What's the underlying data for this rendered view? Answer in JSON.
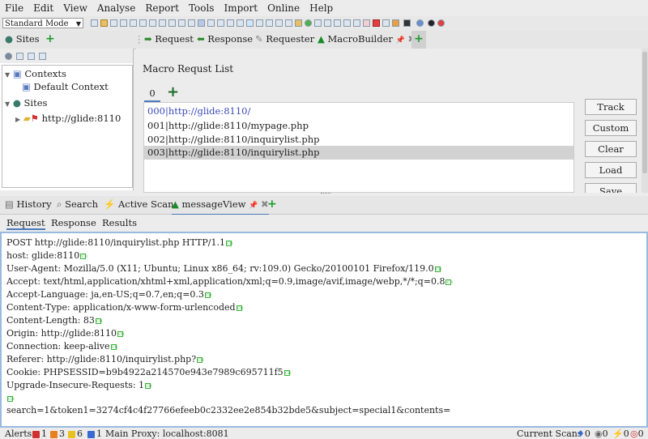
{
  "menu": [
    "File",
    "Edit",
    "View",
    "Analyse",
    "Report",
    "Tools",
    "Import",
    "Online",
    "Help"
  ],
  "toolbar": {
    "mode": "Standard Mode"
  },
  "top_tabs": {
    "sites": "Sites",
    "request": "Request",
    "response": "Response",
    "requester": "Requester",
    "macrobuilder": "MacroBuilder"
  },
  "tree": {
    "contexts": "Contexts",
    "default_context": "Default Context",
    "sites": "Sites",
    "site": "http://glide:8110"
  },
  "macro": {
    "label": "Macro Requst List",
    "tab": "0",
    "rows": [
      "000|http://glide:8110/",
      "001|http://glide:8110/mypage.php",
      "002|http://glide:8110/inquirylist.php",
      "003|http://glide:8110/inquirylist.php"
    ],
    "buttons": [
      "Track",
      "Custom",
      "Clear",
      "Load",
      "Save"
    ]
  },
  "bottom_tabs": {
    "history": "History",
    "search": "Search",
    "active_scan": "Active Scan",
    "message_view": "messageView"
  },
  "sub_tabs": [
    "Request",
    "Response",
    "Results"
  ],
  "message": [
    "POST http://glide:8110/inquirylist.php HTTP/1.1",
    "host: glide:8110",
    "User-Agent: Mozilla/5.0 (X11; Ubuntu; Linux x86_64; rv:109.0) Gecko/20100101 Firefox/119.0",
    "Accept: text/html,application/xhtml+xml,application/xml;q=0.9,image/avif,image/webp,*/*;q=0.8",
    "Accept-Language: ja,en-US;q=0.7,en;q=0.3",
    "Content-Type: application/x-www-form-urlencoded",
    "Content-Length: 83",
    "Origin: http://glide:8110",
    "Connection: keep-alive",
    "Referer: http://glide:8110/inquirylist.php?",
    "Cookie: PHPSESSID=b9b4922a214570e943e7989c695711f5",
    "Upgrade-Insecure-Requests: 1",
    "",
    "search=1&token1=3274cf4c4f27766efeeb0c2332ee2e854b32bde5&subject=special1&contents="
  ],
  "status": {
    "alerts": "Alerts",
    "a_high": "1",
    "a_med": "3",
    "a_low": "6",
    "a_info": "1",
    "proxy": "Main Proxy: localhost:8081",
    "current_scans": "Current Scans",
    "s1": "0",
    "s2": "0",
    "s3": "0",
    "s4": "0"
  }
}
